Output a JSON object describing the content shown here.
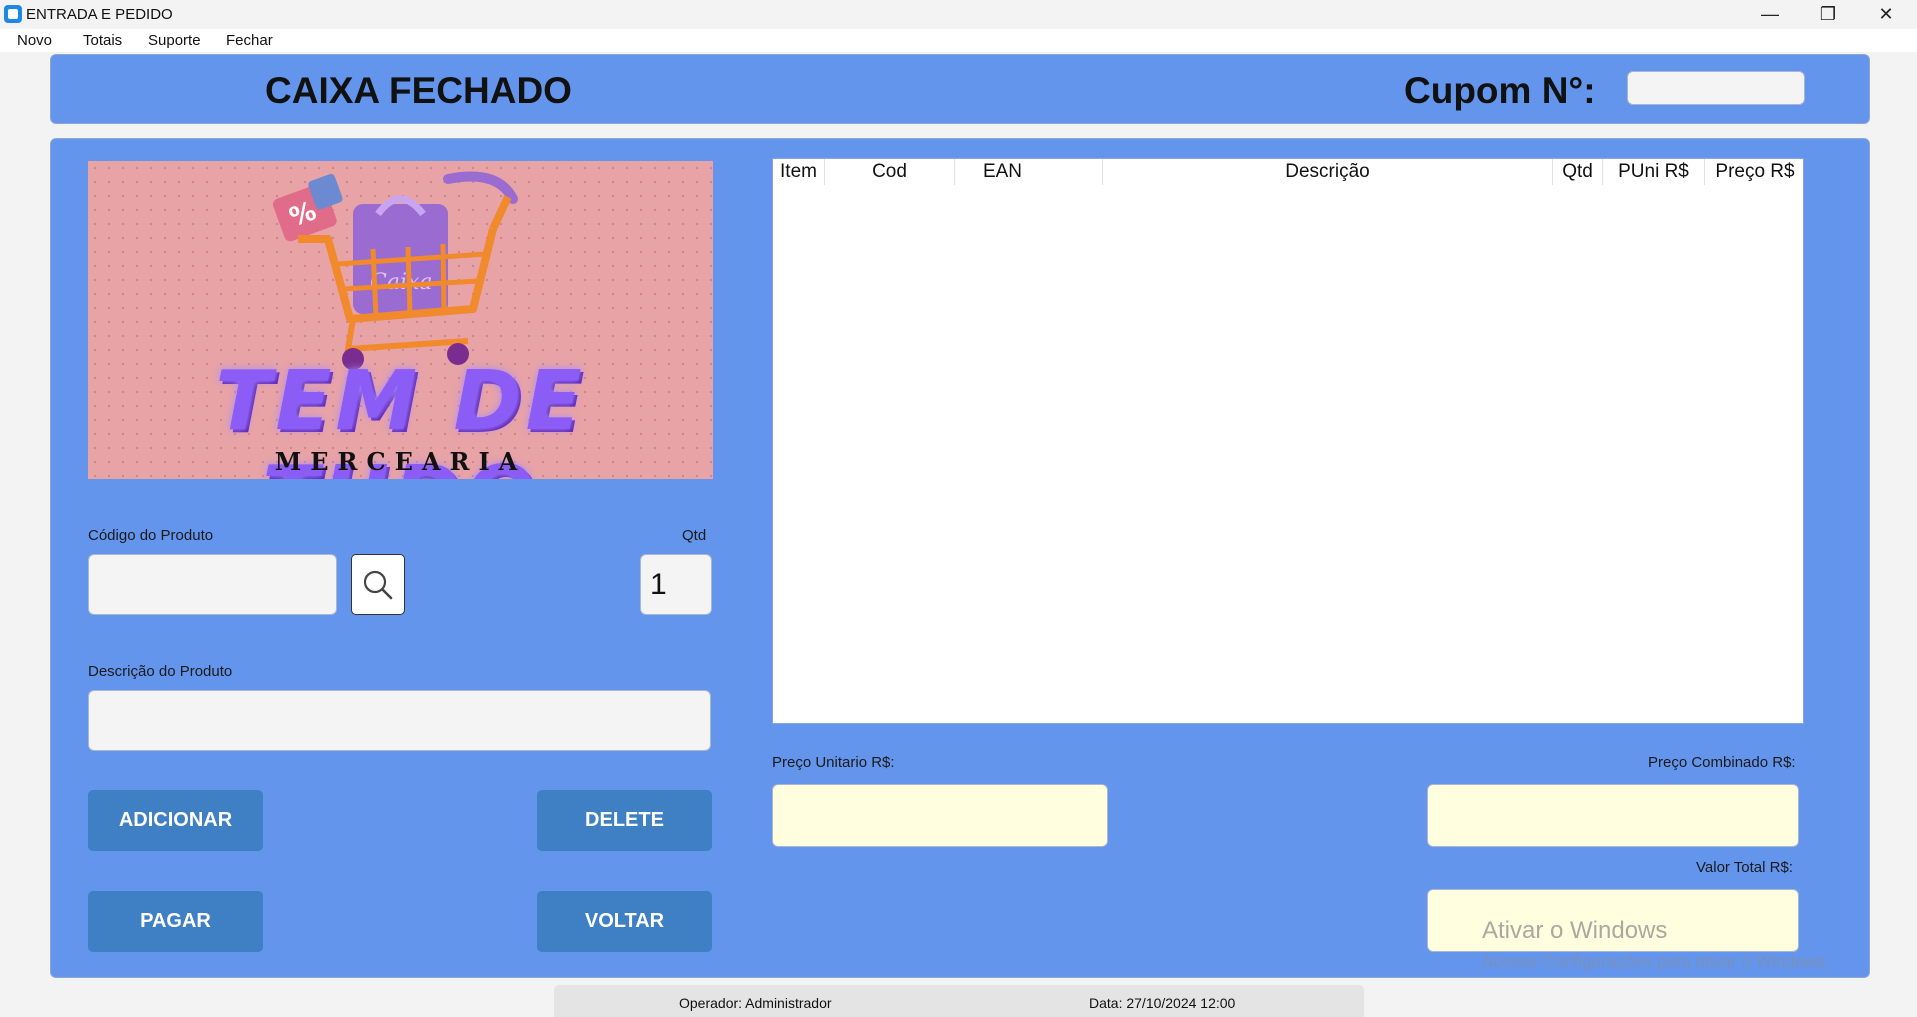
{
  "window": {
    "title": "ENTRADA E PEDIDO",
    "minimize_glyph": "—",
    "restore_glyph": "❐",
    "close_glyph": "✕"
  },
  "menu": {
    "items": [
      "Novo",
      "Totais",
      "Suporte",
      "Fechar"
    ]
  },
  "header": {
    "status": "CAIXA FECHADO",
    "cupom_label": "Cupom N°:",
    "cupom_value": ""
  },
  "logo": {
    "title": "TEM DE TUDO",
    "subtitle": "MERCEARIA",
    "bag_text": "Caixa",
    "tag_text": "%"
  },
  "product": {
    "code_label": "Código do Produto",
    "code_value": "",
    "qty_label": "Qtd",
    "qty_value": "1",
    "desc_label": "Descrição do Produto",
    "desc_value": ""
  },
  "buttons": {
    "add": "ADICIONAR",
    "delete": "DELETE",
    "pay": "PAGAR",
    "back": "VOLTAR"
  },
  "table": {
    "columns": [
      "Item",
      "Cod",
      "EAN",
      "Descrição",
      "Qtd",
      "PUni R$",
      "Preço R$"
    ],
    "rows": []
  },
  "prices": {
    "unit_label": "Preço Unitario R$:",
    "unit_value": "",
    "combined_label": "Preço Combinado R$:",
    "combined_value": "",
    "total_label": "Valor Total R$:",
    "total_value": ""
  },
  "watermark": {
    "line1": "Ativar o Windows",
    "line2": "Acesse Configurações para ativar o Windows."
  },
  "statusbar": {
    "operator": "Operador: Administrador",
    "date": "Data: 27/10/2024 12:00"
  },
  "colors": {
    "panel": "#6495ed",
    "button": "#3f7fc4",
    "price_field": "#ffffe0"
  }
}
